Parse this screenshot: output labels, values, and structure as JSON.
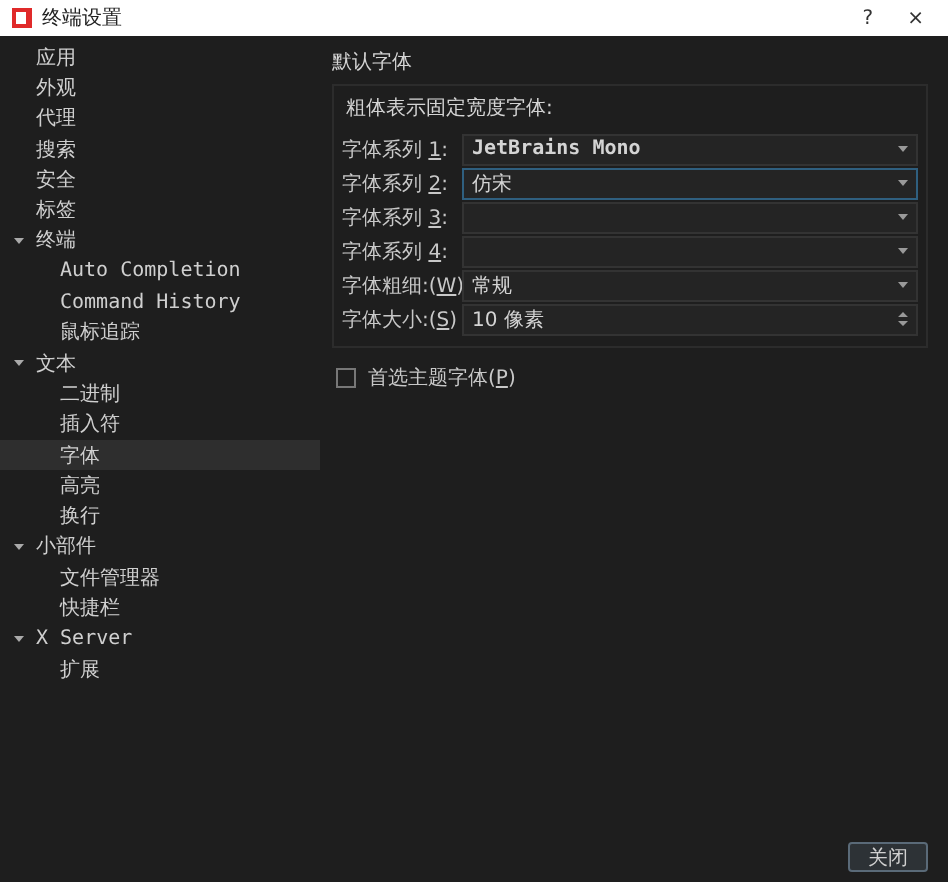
{
  "window": {
    "title": "终端设置",
    "help": "?",
    "close": "×"
  },
  "sidebar": {
    "items": [
      {
        "label": "应用",
        "selected": false
      },
      {
        "label": "外观",
        "selected": false
      },
      {
        "label": "代理",
        "selected": false
      },
      {
        "label": "搜索",
        "selected": false
      },
      {
        "label": "安全",
        "selected": false
      },
      {
        "label": "标签",
        "selected": false
      },
      {
        "label": "终端",
        "selected": false,
        "expanded": true,
        "children": [
          {
            "label": "Auto Completion",
            "selected": false
          },
          {
            "label": "Command History",
            "selected": false
          },
          {
            "label": "鼠标追踪",
            "selected": false
          }
        ]
      },
      {
        "label": "文本",
        "selected": false,
        "expanded": true,
        "children": [
          {
            "label": "二进制",
            "selected": false
          },
          {
            "label": "插入符",
            "selected": false
          },
          {
            "label": "字体",
            "selected": true
          },
          {
            "label": "高亮",
            "selected": false
          },
          {
            "label": "换行",
            "selected": false
          }
        ]
      },
      {
        "label": "小部件",
        "selected": false,
        "expanded": true,
        "children": [
          {
            "label": "文件管理器",
            "selected": false
          },
          {
            "label": "快捷栏",
            "selected": false
          }
        ]
      },
      {
        "label": "X Server",
        "selected": false,
        "expanded": true,
        "children": [
          {
            "label": "扩展",
            "selected": false
          }
        ]
      }
    ]
  },
  "section_title": "默认字体",
  "group": {
    "caption": "粗体表示固定宽度字体:",
    "rows": [
      {
        "label": "字体系列 ",
        "key": "1",
        "suffix": ":",
        "value": "JetBrains Mono",
        "kind": "combo",
        "focused": false,
        "mono": true
      },
      {
        "label": "字体系列 ",
        "key": "2",
        "suffix": ":",
        "value": "仿宋",
        "kind": "combo",
        "focused": true,
        "mono": false
      },
      {
        "label": "字体系列 ",
        "key": "3",
        "suffix": ":",
        "kind": "combo",
        "focused": false
      },
      {
        "label": "字体系列 ",
        "key": "4",
        "suffix": ":",
        "kind": "combo",
        "focused": false
      },
      {
        "label": "字体粗细:(",
        "key": "W",
        "suffix": ")",
        "value": "常规",
        "kind": "combo",
        "focused": false,
        "mono": false
      },
      {
        "label": "字体大小:(",
        "key": "S",
        "suffix": ")",
        "value": "10 像素",
        "kind": "spin",
        "focused": false,
        "mono": false
      }
    ]
  },
  "theme_font": {
    "label": "首选主题字体(",
    "key": "P",
    "suffix": ")",
    "checked": false
  },
  "buttons": [
    "关闭"
  ]
}
